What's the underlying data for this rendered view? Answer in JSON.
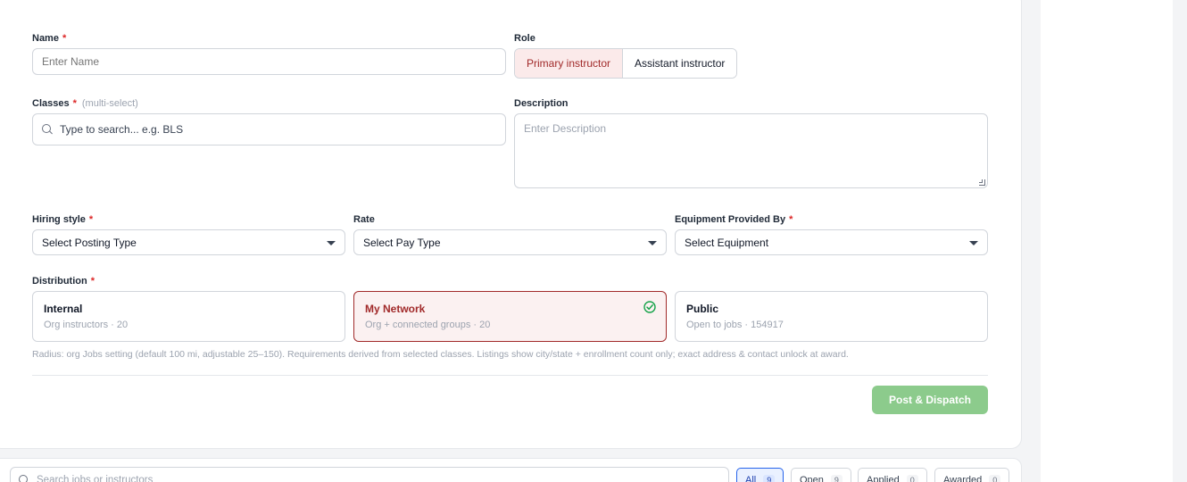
{
  "form": {
    "name": {
      "label": "Name",
      "required": "*",
      "placeholder": "Enter Name"
    },
    "role": {
      "label": "Role",
      "options": [
        "Primary instructor",
        "Assistant instructor"
      ],
      "selected": "Primary instructor"
    },
    "classes": {
      "label": "Classes",
      "required": "*",
      "hint": "(multi-select)",
      "placeholder": "Type to search... e.g. BLS",
      "icon": "search-icon"
    },
    "description": {
      "label": "Description",
      "placeholder": "Enter Description"
    },
    "hiring_style": {
      "label": "Hiring style",
      "required": "*",
      "value": "Select Posting Type"
    },
    "rate": {
      "label": "Rate",
      "value": "Select Pay Type"
    },
    "equipment": {
      "label": "Equipment Provided By",
      "required": "*",
      "value": "Select Equipment"
    },
    "distribution": {
      "label": "Distribution",
      "required": "*",
      "options": [
        {
          "title": "Internal",
          "sub": "Org instructors · 20"
        },
        {
          "title": "My Network",
          "sub": "Org + connected groups · 20"
        },
        {
          "title": "Public",
          "sub": "Open to jobs · 154917"
        }
      ],
      "selected": "My Network",
      "note": "Radius: org Jobs setting (default 100 mi, adjustable 25–150). Requirements derived from selected classes. Listings show city/state + enrollment count only; exact address & contact unlock at award."
    },
    "submit_label": "Post & Dispatch"
  },
  "jobs_bar": {
    "search_placeholder": "Search jobs or instructors",
    "filters": [
      {
        "label": "All",
        "count": "9"
      },
      {
        "label": "Open",
        "count": "9"
      },
      {
        "label": "Applied",
        "count": "0"
      },
      {
        "label": "Awarded",
        "count": "0"
      }
    ],
    "active_filter": "All"
  },
  "colors": {
    "accent": "#a12a2a",
    "required": "#dc2626",
    "submit": "#8ccb8c",
    "active_filter": "#2563eb",
    "check": "#16a34a"
  }
}
